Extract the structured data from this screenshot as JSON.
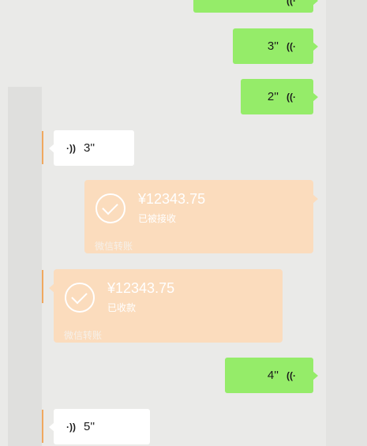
{
  "messages": {
    "voice_sent_1": {
      "duration": "3''",
      "wave_icon": "((·"
    },
    "voice_sent_2": {
      "duration": "2''",
      "wave_icon": "((·"
    },
    "voice_recv_1": {
      "duration": "3''",
      "wave_icon": "·))"
    },
    "transfer_sent": {
      "amount": "¥12343.75",
      "status": "已被接收",
      "footer": "微信转账"
    },
    "transfer_recv": {
      "amount": "¥12343.75",
      "status": "已收款",
      "footer": "微信转账"
    },
    "voice_sent_3": {
      "duration": "4''",
      "wave_icon": "((·"
    },
    "voice_recv_2": {
      "duration": "5''",
      "wave_icon": "·))"
    },
    "voice_sent_top": {
      "wave_icon": "((·"
    }
  },
  "colors": {
    "background": "#eaeae8",
    "sent_bubble": "#95ec69",
    "received_bubble": "#ffffff",
    "transfer_bubble": "#fbdcbd"
  }
}
